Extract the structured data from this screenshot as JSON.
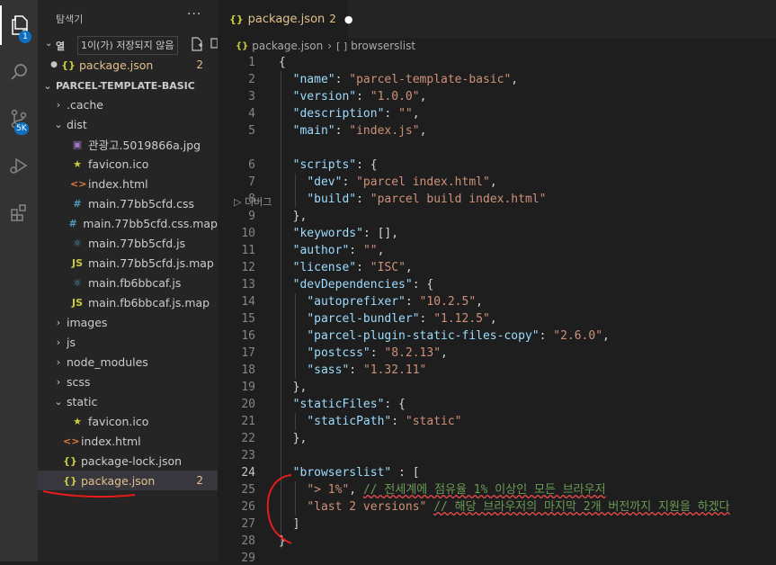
{
  "activity": {
    "explorer_badge": "1",
    "scm_badge": "5K"
  },
  "sidebar": {
    "title": "탐색기",
    "more": "···",
    "open_editors_label": "열",
    "tooltip": "1이(가) 저장되지 않음",
    "open_file": {
      "icon": "{}",
      "name": "package.json",
      "count": "2"
    },
    "folder_title": "PARCEL-TEMPLATE-BASIC",
    "tree": [
      {
        "indent": 1,
        "twisty": "›",
        "icon": "",
        "name": ".cache"
      },
      {
        "indent": 1,
        "twisty": "⌄",
        "icon": "",
        "name": "dist"
      },
      {
        "indent": 2,
        "twisty": "",
        "icon": "▣",
        "name": "관광고.5019866a.jpg"
      },
      {
        "indent": 2,
        "twisty": "",
        "icon": "★",
        "name": "favicon.ico"
      },
      {
        "indent": 2,
        "twisty": "",
        "icon": "<>",
        "name": "index.html"
      },
      {
        "indent": 2,
        "twisty": "",
        "icon": "#",
        "name": "main.77bb5cfd.css"
      },
      {
        "indent": 2,
        "twisty": "",
        "icon": "#",
        "name": "main.77bb5cfd.css.map"
      },
      {
        "indent": 2,
        "twisty": "",
        "icon": "⚛",
        "name": "main.77bb5cfd.js"
      },
      {
        "indent": 2,
        "twisty": "",
        "icon": "JS",
        "name": "main.77bb5cfd.js.map"
      },
      {
        "indent": 2,
        "twisty": "",
        "icon": "⚛",
        "name": "main.fb6bbcaf.js"
      },
      {
        "indent": 2,
        "twisty": "",
        "icon": "JS",
        "name": "main.fb6bbcaf.js.map"
      },
      {
        "indent": 1,
        "twisty": "›",
        "icon": "",
        "name": "images"
      },
      {
        "indent": 1,
        "twisty": "›",
        "icon": "",
        "name": "js"
      },
      {
        "indent": 1,
        "twisty": "›",
        "icon": "",
        "name": "node_modules"
      },
      {
        "indent": 1,
        "twisty": "›",
        "icon": "",
        "name": "scss"
      },
      {
        "indent": 1,
        "twisty": "⌄",
        "icon": "",
        "name": "static"
      },
      {
        "indent": 2,
        "twisty": "",
        "icon": "★",
        "name": "favicon.ico"
      },
      {
        "indent": 1,
        "twisty": "",
        "icon": "<>",
        "name": "index.html"
      },
      {
        "indent": 1,
        "twisty": "",
        "icon": "{}",
        "name": "package-lock.json"
      },
      {
        "indent": 1,
        "twisty": "",
        "icon": "{}",
        "name": "package.json",
        "count": "2",
        "modified": true
      }
    ]
  },
  "tab": {
    "icon": "{}",
    "name": "package.json",
    "count": "2",
    "dirty": "●"
  },
  "breadcrumb": {
    "file_icon": "{}",
    "file": "package.json",
    "sep": "›",
    "node_icon": "[ ]",
    "node": "browserslist"
  },
  "codelens": "▷ 디버그",
  "lines": [
    {
      "n": "1",
      "tokens": [
        [
          "p",
          "{"
        ]
      ]
    },
    {
      "n": "2",
      "tokens": [
        [
          "p",
          "  "
        ],
        [
          "k",
          "\"name\""
        ],
        [
          "p",
          ": "
        ],
        [
          "s",
          "\"parcel-template-basic\""
        ],
        [
          "p",
          ","
        ]
      ]
    },
    {
      "n": "3",
      "tokens": [
        [
          "p",
          "  "
        ],
        [
          "k",
          "\"version\""
        ],
        [
          "p",
          ": "
        ],
        [
          "s",
          "\"1.0.0\""
        ],
        [
          "p",
          ","
        ]
      ]
    },
    {
      "n": "4",
      "tokens": [
        [
          "p",
          "  "
        ],
        [
          "k",
          "\"description\""
        ],
        [
          "p",
          ": "
        ],
        [
          "s",
          "\"\""
        ],
        [
          "p",
          ","
        ]
      ]
    },
    {
      "n": "5",
      "tokens": [
        [
          "p",
          "  "
        ],
        [
          "k",
          "\"main\""
        ],
        [
          "p",
          ": "
        ],
        [
          "s",
          "\"index.js\""
        ],
        [
          "p",
          ","
        ]
      ]
    },
    {
      "n": "6",
      "tokens": [
        [
          "p",
          "  "
        ],
        [
          "k",
          "\"scripts\""
        ],
        [
          "p",
          ": {"
        ]
      ]
    },
    {
      "n": "7",
      "tokens": [
        [
          "p",
          "    "
        ],
        [
          "k",
          "\"dev\""
        ],
        [
          "p",
          ": "
        ],
        [
          "s",
          "\"parcel index.html\""
        ],
        [
          "p",
          ","
        ]
      ]
    },
    {
      "n": "8",
      "tokens": [
        [
          "p",
          "    "
        ],
        [
          "k",
          "\"build\""
        ],
        [
          "p",
          ": "
        ],
        [
          "s",
          "\"parcel build index.html\""
        ]
      ]
    },
    {
      "n": "9",
      "tokens": [
        [
          "p",
          "  },"
        ]
      ]
    },
    {
      "n": "10",
      "tokens": [
        [
          "p",
          "  "
        ],
        [
          "k",
          "\"keywords\""
        ],
        [
          "p",
          ": [],"
        ]
      ]
    },
    {
      "n": "11",
      "tokens": [
        [
          "p",
          "  "
        ],
        [
          "k",
          "\"author\""
        ],
        [
          "p",
          ": "
        ],
        [
          "s",
          "\"\""
        ],
        [
          "p",
          ","
        ]
      ]
    },
    {
      "n": "12",
      "tokens": [
        [
          "p",
          "  "
        ],
        [
          "k",
          "\"license\""
        ],
        [
          "p",
          ": "
        ],
        [
          "s",
          "\"ISC\""
        ],
        [
          "p",
          ","
        ]
      ]
    },
    {
      "n": "13",
      "tokens": [
        [
          "p",
          "  "
        ],
        [
          "k",
          "\"devDependencies\""
        ],
        [
          "p",
          ": {"
        ]
      ]
    },
    {
      "n": "14",
      "tokens": [
        [
          "p",
          "    "
        ],
        [
          "k",
          "\"autoprefixer\""
        ],
        [
          "p",
          ": "
        ],
        [
          "s",
          "\"10.2.5\""
        ],
        [
          "p",
          ","
        ]
      ]
    },
    {
      "n": "15",
      "tokens": [
        [
          "p",
          "    "
        ],
        [
          "k",
          "\"parcel-bundler\""
        ],
        [
          "p",
          ": "
        ],
        [
          "s",
          "\"1.12.5\""
        ],
        [
          "p",
          ","
        ]
      ]
    },
    {
      "n": "16",
      "tokens": [
        [
          "p",
          "    "
        ],
        [
          "k",
          "\"parcel-plugin-static-files-copy\""
        ],
        [
          "p",
          ": "
        ],
        [
          "s",
          "\"2.6.0\""
        ],
        [
          "p",
          ","
        ]
      ]
    },
    {
      "n": "17",
      "tokens": [
        [
          "p",
          "    "
        ],
        [
          "k",
          "\"postcss\""
        ],
        [
          "p",
          ": "
        ],
        [
          "s",
          "\"8.2.13\""
        ],
        [
          "p",
          ","
        ]
      ]
    },
    {
      "n": "18",
      "tokens": [
        [
          "p",
          "    "
        ],
        [
          "k",
          "\"sass\""
        ],
        [
          "p",
          ": "
        ],
        [
          "s",
          "\"1.32.11\""
        ]
      ]
    },
    {
      "n": "19",
      "tokens": [
        [
          "p",
          "  },"
        ]
      ]
    },
    {
      "n": "20",
      "tokens": [
        [
          "p",
          "  "
        ],
        [
          "k",
          "\"staticFiles\""
        ],
        [
          "p",
          ": {"
        ]
      ]
    },
    {
      "n": "21",
      "tokens": [
        [
          "p",
          "    "
        ],
        [
          "k",
          "\"staticPath\""
        ],
        [
          "p",
          ": "
        ],
        [
          "s",
          "\"static\""
        ]
      ]
    },
    {
      "n": "22",
      "tokens": [
        [
          "p",
          "  },"
        ]
      ]
    },
    {
      "n": "23",
      "tokens": []
    },
    {
      "n": "24",
      "tokens": [
        [
          "p",
          "  "
        ],
        [
          "k",
          "\"browserslist\""
        ],
        [
          "p",
          " : ["
        ]
      ]
    },
    {
      "n": "25",
      "tokens": [
        [
          "p",
          "    "
        ],
        [
          "s",
          "\"> 1%\""
        ],
        [
          "p",
          ", "
        ],
        [
          "c",
          "// 전세계에 점유율 1% 이상인 모든 브라우저"
        ]
      ]
    },
    {
      "n": "26",
      "tokens": [
        [
          "p",
          "    "
        ],
        [
          "s",
          "\"last 2 versions\""
        ],
        [
          "p",
          " "
        ],
        [
          "c",
          "// 해당 브라우저의 마지막 2개 버전까지 지원을 하겠다"
        ]
      ]
    },
    {
      "n": "27",
      "tokens": [
        [
          "p",
          "  ]"
        ]
      ]
    },
    {
      "n": "28",
      "tokens": [
        [
          "p",
          "}"
        ]
      ]
    },
    {
      "n": "29",
      "tokens": []
    }
  ],
  "colors": {
    "modified": "#e2c08d",
    "annotation": "#e51c1c",
    "accent": "#0e70c0"
  }
}
